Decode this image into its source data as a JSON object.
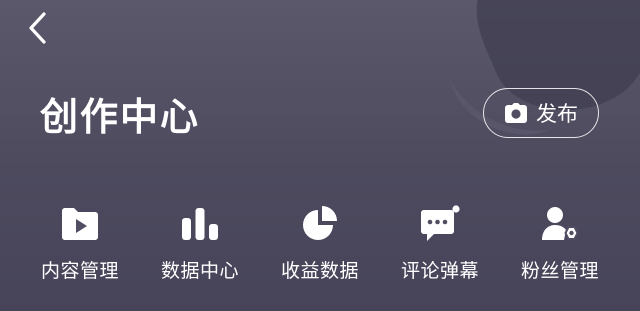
{
  "header": {
    "back_icon": "chevron-left-icon",
    "title": "创作中心",
    "publish": {
      "icon": "camera-icon",
      "label": "发布"
    }
  },
  "menu": {
    "items": [
      {
        "icon": "folder-play-icon",
        "label": "内容管理"
      },
      {
        "icon": "bar-chart-icon",
        "label": "数据中心"
      },
      {
        "icon": "pie-chart-icon",
        "label": "收益数据"
      },
      {
        "icon": "comment-bubble-icon",
        "label": "评论弹幕"
      },
      {
        "icon": "user-gear-icon",
        "label": "粉丝管理"
      }
    ]
  },
  "colors": {
    "background": "#514e63",
    "text": "#ffffff",
    "icon_cutout": "#514e63"
  }
}
